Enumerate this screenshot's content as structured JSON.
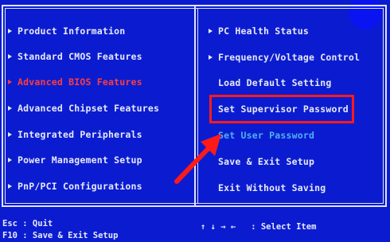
{
  "left_menu": [
    {
      "label": "Product Information",
      "state": "normal"
    },
    {
      "label": "Standard CMOS Features",
      "state": "normal"
    },
    {
      "label": "Advanced BIOS Features",
      "state": "selected"
    },
    {
      "label": "Advanced Chipset Features",
      "state": "normal"
    },
    {
      "label": "Integrated Peripherals",
      "state": "normal"
    },
    {
      "label": "Power Management Setup",
      "state": "normal"
    },
    {
      "label": "PnP/PCI Configurations",
      "state": "normal"
    }
  ],
  "right_menu": [
    {
      "label": "PC Health Status",
      "arrow": true,
      "state": "normal"
    },
    {
      "label": "Frequency/Voltage Control",
      "arrow": true,
      "state": "normal"
    },
    {
      "label": "Load Default Setting",
      "arrow": false,
      "state": "normal"
    },
    {
      "label": "Set Supervisor Password",
      "arrow": false,
      "state": "highlighted"
    },
    {
      "label": "Set User Password",
      "arrow": false,
      "state": "disabled"
    },
    {
      "label": "Save & Exit Setup",
      "arrow": false,
      "state": "normal"
    },
    {
      "label": "Exit Without Saving",
      "arrow": false,
      "state": "normal"
    }
  ],
  "footer": {
    "esc_hint": "Esc : Quit",
    "f10_hint": "F10 : Save & Exit Setup",
    "nav_hint": "↑ ↓ → ←   : Select Item"
  },
  "colors": {
    "background": "#0b1cd0",
    "text": "#e6e9f8",
    "selected": "#ff3c3c",
    "disabled": "#4fb0f2",
    "annotation": "#ff1a1a"
  }
}
